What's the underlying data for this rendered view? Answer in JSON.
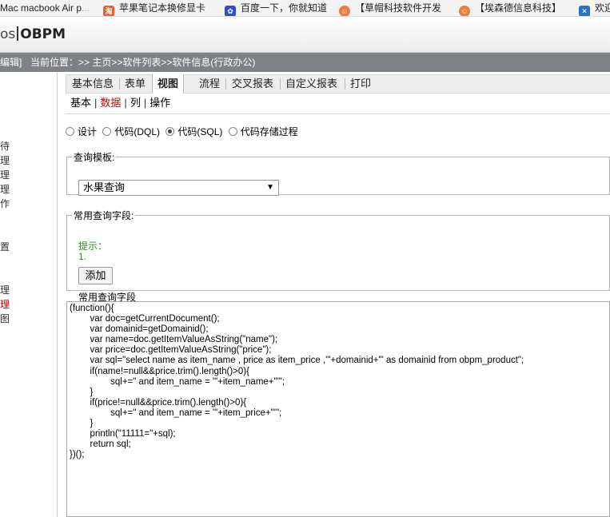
{
  "bookmarks": [
    {
      "label": "Mac macbook Air p",
      "icon": "apple-icon"
    },
    {
      "label": "苹果笔记本换修显卡",
      "icon": "repair-icon"
    },
    {
      "label": "百度一下，你就知道",
      "icon": "baidu-paw-icon"
    },
    {
      "label": "【草帽科技软件开发",
      "icon": "orange-face-icon"
    },
    {
      "label": "【埃森德信息科技】",
      "icon": "orange-face-icon"
    },
    {
      "label": "欢迎",
      "icon": "blue-x-icon"
    }
  ],
  "header": {
    "logo_prefix": "os",
    "logo_name": "OBPM"
  },
  "location": {
    "edit_label": "编辑]",
    "breadcrumb": "当前位置：>> 主页>>软件列表>>软件信息(行政办公)"
  },
  "leftnav": [
    "待",
    "理",
    "理",
    "理",
    "作",
    "置",
    "理",
    "理",
    "图"
  ],
  "tabs": [
    "基本信息",
    "表单",
    "视图",
    "流程",
    "交叉报表",
    "自定义报表",
    "打印"
  ],
  "active_tab": "视图",
  "subtabs": [
    "基本",
    "数据",
    "列",
    "操作"
  ],
  "active_subtab": "数据",
  "radio_options": [
    {
      "label": "设计",
      "checked": false
    },
    {
      "label": "代码(DQL)",
      "checked": false
    },
    {
      "label": "代码(SQL)",
      "checked": true
    },
    {
      "label": "代码存储过程",
      "checked": false
    }
  ],
  "query_template": {
    "legend": "查询模板:",
    "selected": "水果查询"
  },
  "common_fields": {
    "legend": "常用查询字段:",
    "hint_title": "提示：",
    "hint_item": "1.",
    "add_button": "添加",
    "field_label": "常用查询字段"
  },
  "code": "(function(){\n        var doc=getCurrentDocument();\n        var domainid=getDomainid();\n        var name=doc.getItemValueAsString(\"name\");\n        var price=doc.getItemValueAsString(\"price\");\n        var sql=\"select name as item_name , price as item_price ,'\"+domainid+\"' as domainid from obpm_product\";\n        if(name!=null&&price.trim().length()>0){\n                sql+=\" and item_name = '\"+item_name+\"'\";\n        }\n        if(price!=null&&price.trim().length()>0){\n                sql+=\" and item_name = '\"+item_price+\"'\";\n        }\n        println(\"11111=\"+sql);\n        return sql;\n})();",
  "colors": {
    "location_bar": "#7e8287",
    "hint": "#2b8a1e",
    "active": "#d00000"
  }
}
